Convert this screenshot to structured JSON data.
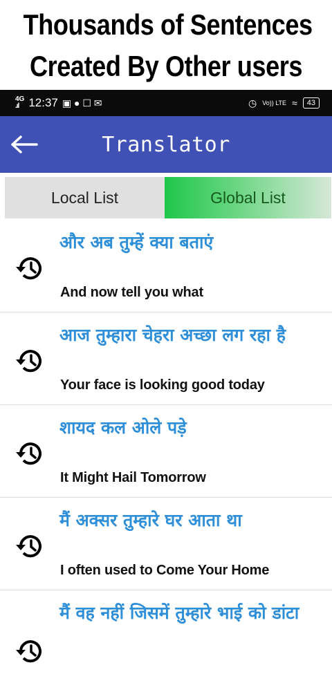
{
  "promo": {
    "line1": "Thousands of Sentences",
    "line2": "Created By Other users"
  },
  "status_bar": {
    "network": "4G",
    "time": "12:37",
    "lte": "Vo)) LTE",
    "battery": "43"
  },
  "app_bar": {
    "title": "Translator",
    "back_icon": "arrow-left-icon"
  },
  "tabs": [
    {
      "label": "Local List",
      "active": false
    },
    {
      "label": "Global List",
      "active": true
    }
  ],
  "sentences": [
    {
      "hindi": "और अब तुम्हें क्या बताएं",
      "english": "And now tell you what"
    },
    {
      "hindi": "आज तुम्हारा चेहरा अच्छा लग रहा है",
      "english": "Your face is looking good today"
    },
    {
      "hindi": "शायद कल ओले पड़े",
      "english": "It Might Hail Tomorrow"
    },
    {
      "hindi": "मैं अक्सर तुम्हारे घर आता था",
      "english": "I often used to Come Your Home"
    },
    {
      "hindi": "मैं वह नहीं जिसमें तुम्हारे भाई को डांटा",
      "english": ""
    }
  ],
  "colors": {
    "app_bar": "#3f51b5",
    "hindi_text": "#2e8ed8",
    "active_tab": "#1fc74a"
  }
}
